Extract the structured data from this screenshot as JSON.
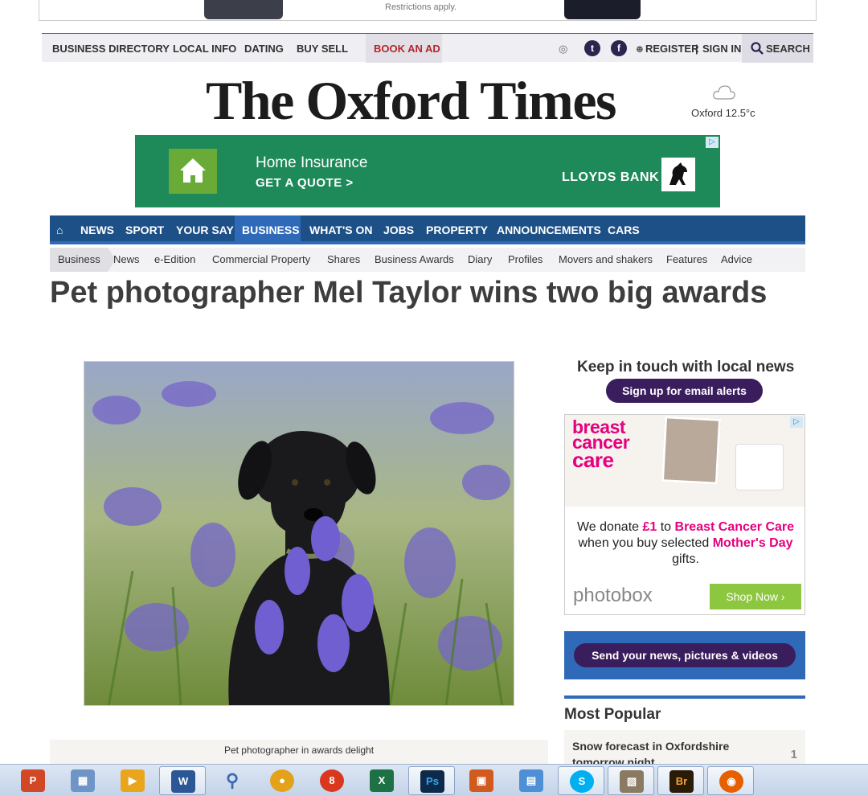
{
  "top_ad": {
    "note": "Restrictions apply."
  },
  "utility_bar": {
    "links": [
      "BUSINESS DIRECTORY",
      "LOCAL INFO",
      "DATING",
      "BUY SELL"
    ],
    "book_ad": "BOOK AN AD",
    "register": "REGISTER",
    "separator": "|",
    "sign_in": "SIGN IN",
    "search": "SEARCH"
  },
  "masthead": {
    "title": "The Oxford Times",
    "weather": "Oxford 12.5°c"
  },
  "banner_ad": {
    "line1": "Home Insurance",
    "line2": "GET A QUOTE >",
    "brand": "LLOYDS BANK"
  },
  "main_nav": {
    "home_icon": "home-icon",
    "items": [
      "NEWS",
      "SPORT",
      "YOUR SAY",
      "BUSINESS",
      "WHAT'S ON",
      "JOBS",
      "PROPERTY",
      "ANNOUNCEMENTS",
      "CARS"
    ],
    "active": "BUSINESS",
    "bar_color": "#1d5086",
    "accent_color": "#2e6ab8"
  },
  "sub_nav": {
    "items": [
      "Business",
      "News",
      "e-Edition",
      "Commercial Property",
      "Shares",
      "Business Awards",
      "Diary",
      "Profiles",
      "Movers and shakers",
      "Features",
      "Advice"
    ]
  },
  "article": {
    "headline": "Pet photographer Mel Taylor wins two big awards",
    "caption": "Pet photographer in awards delight"
  },
  "sidebar": {
    "keep_in_touch": "Keep in touch with local news",
    "signup": "Sign up for email alerts",
    "ad": {
      "logo_line1": "breast",
      "logo_line2": "cancer",
      "logo_line3": "care",
      "text_a": "We donate ",
      "amount": "£1",
      "text_b": " to ",
      "charity": "Breast Cancer Care",
      "text_c": " when you buy selected ",
      "occasion": "Mother's Day",
      "text_d": " gifts.",
      "brand": "photobox",
      "cta": "Shop Now ›"
    },
    "send_news": "Send your news, pictures & videos",
    "most_popular": {
      "title": "Most Popular",
      "items": [
        {
          "rank": "1",
          "title": "Snow forecast in Oxfordshire tomorrow night"
        }
      ]
    }
  },
  "taskbar": {
    "apps": [
      "powerpoint-icon",
      "photo-gallery-icon",
      "movie-maker-icon",
      "word-icon",
      "search-icon",
      "chrome-icon",
      "app8-icon",
      "excel-icon",
      "photoshop-icon",
      "app-orange-icon",
      "app-folder-icon",
      "skype-icon",
      "image-viewer-icon",
      "bridge-icon",
      "firefox-icon"
    ]
  }
}
